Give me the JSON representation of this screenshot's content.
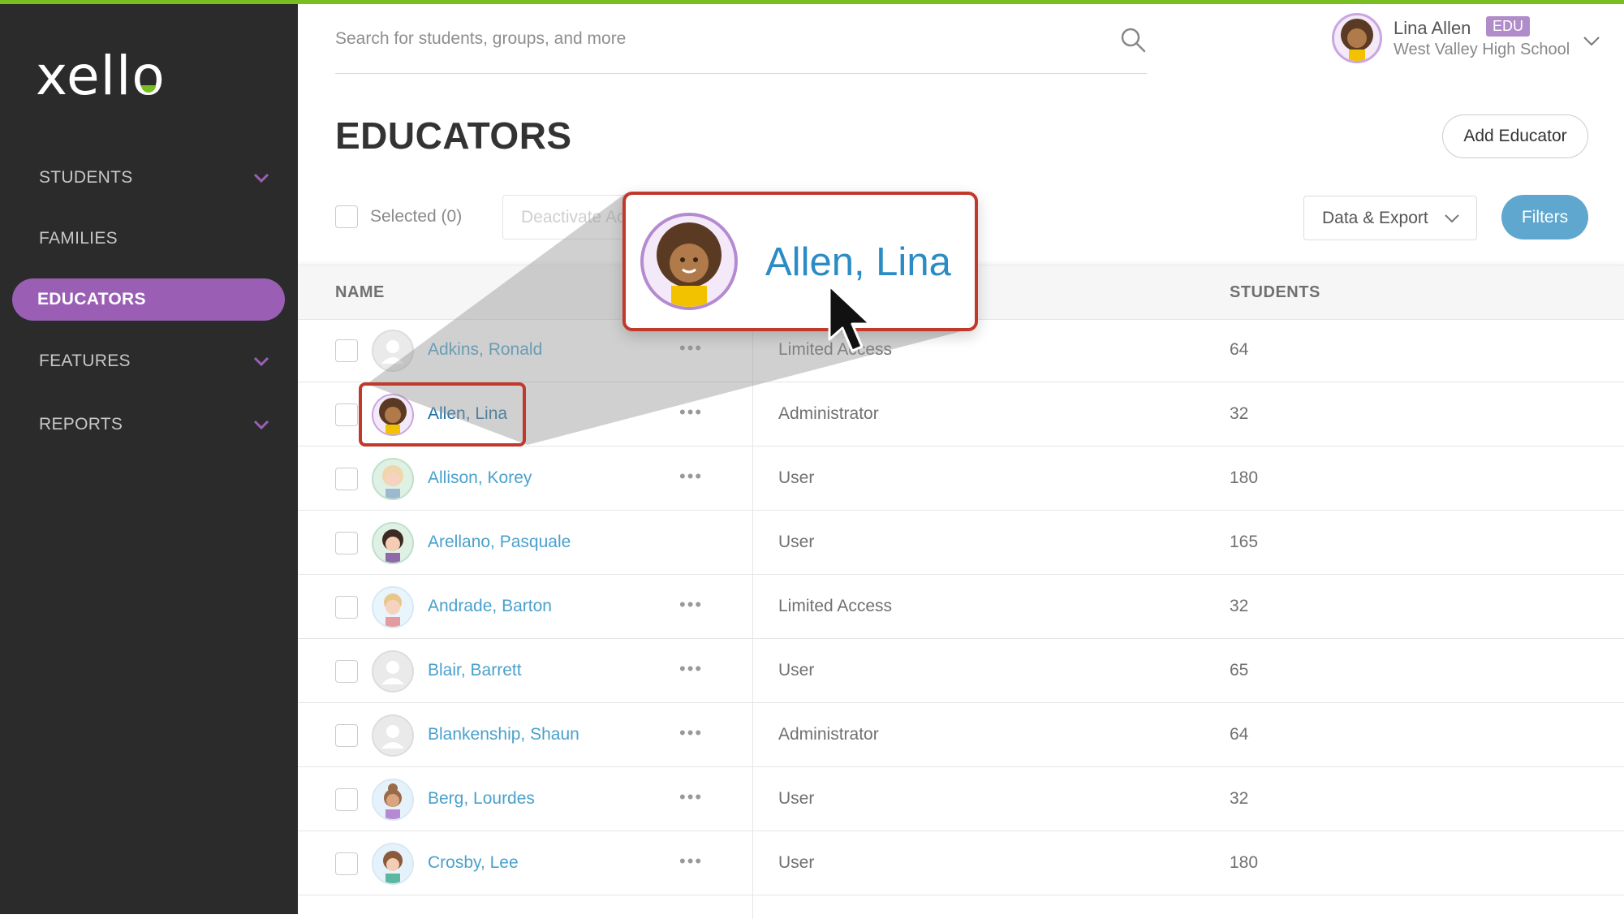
{
  "app": {
    "logo_text": "xello"
  },
  "sidebar": {
    "items": [
      {
        "label": "STUDENTS",
        "has_chevron": true
      },
      {
        "label": "FAMILIES",
        "has_chevron": false
      },
      {
        "label": "EDUCATORS",
        "has_chevron": false,
        "active": true
      },
      {
        "label": "FEATURES",
        "has_chevron": true
      },
      {
        "label": "REPORTS",
        "has_chevron": true
      }
    ]
  },
  "search": {
    "placeholder": "Search for students, groups, and more",
    "icon": "search-icon"
  },
  "user": {
    "name": "Lina Allen",
    "badge": "EDU",
    "school": "West Valley High School"
  },
  "page": {
    "title": "EDUCATORS",
    "add_button": "Add Educator"
  },
  "toolbar": {
    "selected_label": "Selected (0)",
    "deactivate_label": "Deactivate Account",
    "data_export_label": "Data & Export",
    "filters_label": "Filters"
  },
  "table": {
    "headers": {
      "name": "NAME",
      "students": "STUDENTS"
    },
    "rows": [
      {
        "name": "Adkins, Ronald",
        "role": "Limited Access",
        "students": "64",
        "has_menu": true
      },
      {
        "name": "Allen, Lina",
        "role": "Administrator",
        "students": "32",
        "has_menu": true
      },
      {
        "name": "Allison, Korey",
        "role": "User",
        "students": "180",
        "has_menu": true
      },
      {
        "name": "Arellano, Pasquale",
        "role": "User",
        "students": "165",
        "has_menu": false
      },
      {
        "name": "Andrade, Barton",
        "role": "Limited Access",
        "students": "32",
        "has_menu": true
      },
      {
        "name": "Blair, Barrett",
        "role": "User",
        "students": "65",
        "has_menu": true
      },
      {
        "name": "Blankenship, Shaun",
        "role": "Administrator",
        "students": "64",
        "has_menu": true
      },
      {
        "name": "Berg, Lourdes",
        "role": "User",
        "students": "32",
        "has_menu": true
      },
      {
        "name": "Crosby, Lee",
        "role": "User",
        "students": "180",
        "has_menu": true
      }
    ],
    "menu_glyph": "•••"
  },
  "callout": {
    "name": "Allen, Lina"
  },
  "colors": {
    "sidebar_bg": "#2b2b2b",
    "active_nav": "#9a5fb5",
    "link_blue": "#4aa0cc",
    "accent_green": "#78be20",
    "filters_blue": "#5fa7cf",
    "highlight_red": "#c0392b"
  }
}
